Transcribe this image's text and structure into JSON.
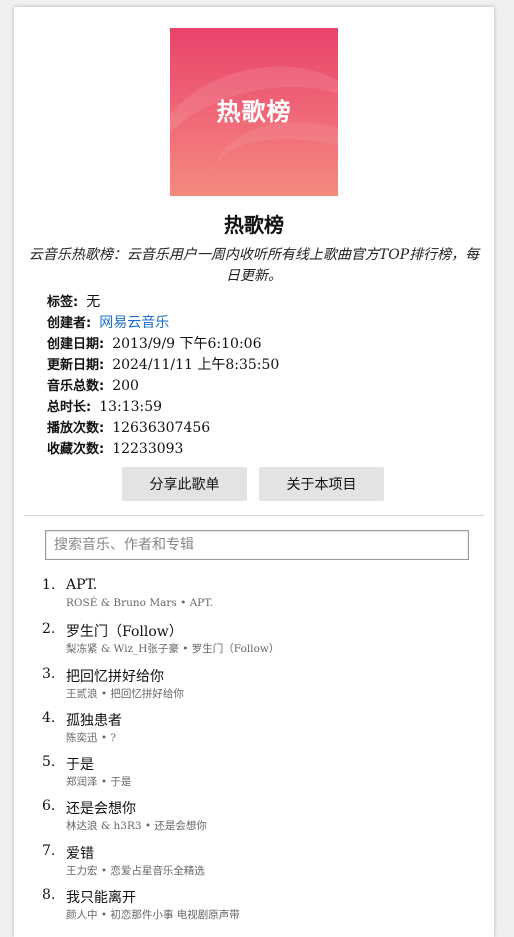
{
  "playlist": {
    "cover_text": "热歌榜",
    "title": "热歌榜",
    "description": "云音乐热歌榜：云音乐用户一周内收听所有线上歌曲官方TOP排行榜，每日更新。",
    "meta": {
      "tags_label": "标签:",
      "tags_value": "无",
      "creator_label": "创建者:",
      "creator_value": "网易云音乐",
      "created_label": "创建日期:",
      "created_value": "2013/9/9 下午6:10:06",
      "updated_label": "更新日期:",
      "updated_value": "2024/11/11 上午8:35:50",
      "count_label": "音乐总数:",
      "count_value": "200",
      "duration_label": "总时长:",
      "duration_value": "13:13:59",
      "plays_label": "播放次数:",
      "plays_value": "12636307456",
      "favs_label": "收藏次数:",
      "favs_value": "12233093"
    },
    "buttons": {
      "share": "分享此歌单",
      "about": "关于本项目"
    }
  },
  "search": {
    "placeholder": "搜索音乐、作者和专辑"
  },
  "songs": [
    {
      "num": "1.",
      "title": "APT.",
      "sub": "ROSÉ & Bruno Mars • APT."
    },
    {
      "num": "2.",
      "title": "罗生门（Follow）",
      "sub": "梨冻紧 & Wiz_H张子豪 • 罗生门（Follow）"
    },
    {
      "num": "3.",
      "title": "把回忆拼好给你",
      "sub": "王贰浪 • 把回忆拼好给你"
    },
    {
      "num": "4.",
      "title": "孤独患者",
      "sub": "陈奕迅 • ?"
    },
    {
      "num": "5.",
      "title": "于是",
      "sub": "郑润泽 • 于是"
    },
    {
      "num": "6.",
      "title": "还是会想你",
      "sub": "林达浪 & h3R3 • 还是会想你"
    },
    {
      "num": "7.",
      "title": "爱错",
      "sub": "王力宏 • 恋爱占星音乐全精选"
    },
    {
      "num": "8.",
      "title": "我只能离开",
      "sub": "颜人中 • 初恋那件小事 电视剧原声带"
    }
  ]
}
